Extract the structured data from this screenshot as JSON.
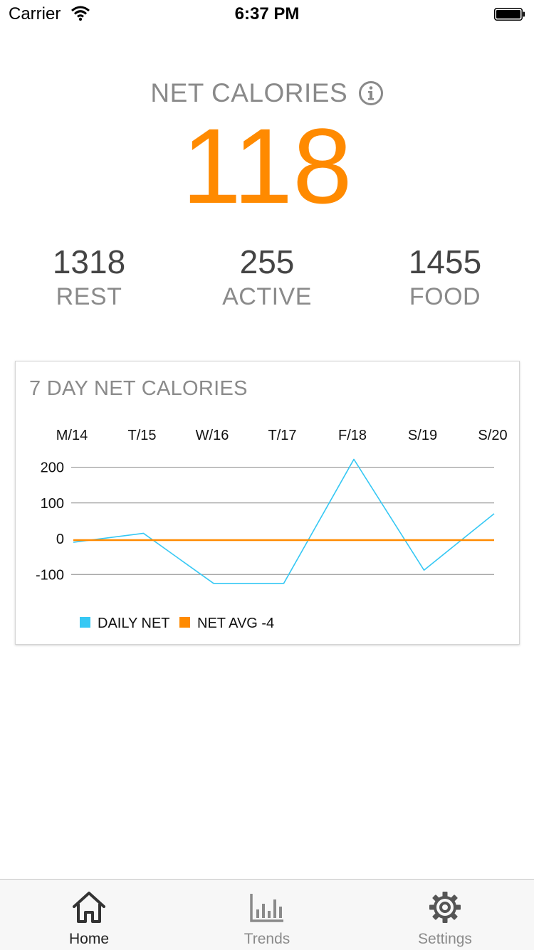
{
  "status_bar": {
    "carrier": "Carrier",
    "time": "6:37 PM"
  },
  "summary": {
    "title": "NET CALORIES",
    "net_value": "118",
    "stats": [
      {
        "value": "1318",
        "label": "REST"
      },
      {
        "value": "255",
        "label": "ACTIVE"
      },
      {
        "value": "1455",
        "label": "FOOD"
      }
    ]
  },
  "card": {
    "title": "7 DAY NET CALORIES"
  },
  "chart_data": {
    "type": "line",
    "categories": [
      "M/14",
      "T/15",
      "W/16",
      "T/17",
      "F/18",
      "S/19",
      "S/20"
    ],
    "series": [
      {
        "name": "DAILY NET",
        "color": "#36c8f4",
        "values": [
          -10,
          15,
          -125,
          -125,
          222,
          -88,
          70
        ]
      },
      {
        "name": "NET AVG -4",
        "color": "#ff8a00",
        "values": [
          -4,
          -4,
          -4,
          -4,
          -4,
          -4,
          -4
        ]
      }
    ],
    "yticks": [
      200,
      100,
      0,
      -100
    ],
    "ylim": [
      -100,
      200
    ],
    "grid": true,
    "legend": "bottom-left"
  },
  "tabbar": {
    "tabs": [
      {
        "label": "Home",
        "icon": "home-icon",
        "active": true
      },
      {
        "label": "Trends",
        "icon": "bar-chart-icon",
        "active": false
      },
      {
        "label": "Settings",
        "icon": "gear-icon",
        "active": false
      }
    ]
  }
}
